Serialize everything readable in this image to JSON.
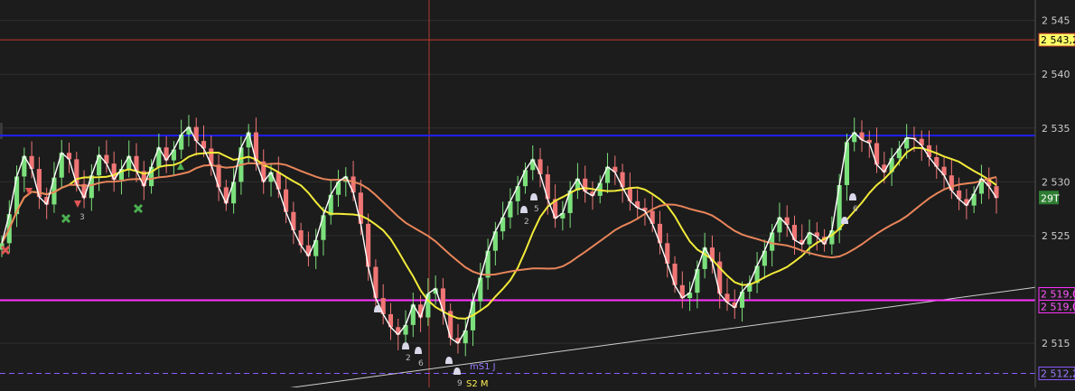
{
  "chart_data": {
    "type": "candlestick",
    "title": "",
    "xlabel": "",
    "ylabel": "",
    "grid": true,
    "ylim": [
      2510.9,
      2546.9
    ],
    "y_ticks": [
      2545,
      2540,
      2535,
      2530,
      2525,
      2515
    ],
    "y_tick_labels": [
      "2 545",
      "2 540",
      "2 535",
      "2 530",
      "2 525",
      "2 515"
    ],
    "price_series_close": [
      2524.3,
      2527.0,
      2530.5,
      2532.4,
      2531.2,
      2528.6,
      2527.9,
      2530.4,
      2532.7,
      2532.1,
      2529.8,
      2528.5,
      2530.6,
      2532.5,
      2531.7,
      2530.2,
      2531.2,
      2532.4,
      2531.0,
      2529.6,
      2531.4,
      2533.2,
      2532.0,
      2533.0,
      2534.4,
      2535.1,
      2533.8,
      2533.1,
      2531.6,
      2529.5,
      2528.0,
      2530.0,
      2533.2,
      2534.6,
      2531.9,
      2530.0,
      2530.9,
      2529.3,
      2527.2,
      2525.5,
      2524.1,
      2523.1,
      2524.6,
      2526.9,
      2528.8,
      2530.0,
      2530.5,
      2529.0,
      2526.1,
      2522.1,
      2519.2,
      2517.7,
      2516.5,
      2515.8,
      2516.7,
      2518.6,
      2517.4,
      2519.6,
      2520.1,
      2518.0,
      2515.5,
      2515.0,
      2516.2,
      2518.9,
      2521.1,
      2523.6,
      2525.4,
      2526.7,
      2528.2,
      2529.6,
      2531.1,
      2532.1,
      2530.7,
      2528.4,
      2526.6,
      2527.1,
      2529.2,
      2530.3,
      2529.1,
      2528.7,
      2529.9,
      2531.4,
      2530.9,
      2529.5,
      2528.2,
      2527.6,
      2527.3,
      2526.1,
      2524.3,
      2522.4,
      2520.4,
      2519.2,
      2519.7,
      2521.9,
      2523.9,
      2522.6,
      2519.6,
      2518.8,
      2518.3,
      2519.8,
      2520.6,
      2522.2,
      2523.6,
      2525.3,
      2526.7,
      2526.0,
      2524.6,
      2524.2,
      2525.3,
      2524.9,
      2524.2,
      2525.5,
      2529.7,
      2533.7,
      2534.6,
      2533.9,
      2533.6,
      2531.6,
      2530.9,
      2532.2,
      2533.1,
      2534.1,
      2534.0,
      2533.4,
      2532.3,
      2531.4,
      2530.6,
      2529.2,
      2528.4,
      2527.8,
      2528.9,
      2530.3,
      2529.6,
      2528.5
    ],
    "moving_averages": [
      {
        "color": "#f2ea3a",
        "period": 10
      },
      {
        "color": "#e8855a",
        "period": 26
      }
    ],
    "horizontal_lines": [
      {
        "value": 2543.2,
        "color": "#c0392b",
        "label": "2 543,2!",
        "label_bg": "#ffff66",
        "label_color": "#000000"
      },
      {
        "value": 2534.3,
        "color": "#2020ff",
        "label": "",
        "label_bg": "",
        "label_color": ""
      },
      {
        "value": 2519.0,
        "color": "#ff33ff",
        "label": "2 519,0",
        "label_bg": "#1c1c1c",
        "label_color": "#ff55ff"
      },
      {
        "value": 2519.0,
        "color": "#ff33ff",
        "label": "2 519,0",
        "label_bg": "#1c1c1c",
        "label_color": "#ff55ff"
      },
      {
        "value": 2512.2,
        "color": "#8a5cff",
        "label": "2 512,2",
        "label_bg": "#1c1c1c",
        "label_color": "#9b7bff",
        "dashed": true
      }
    ],
    "trend_line": {
      "from": [
        0.26,
        2510.6
      ],
      "to": [
        1.0,
        2520.2
      ],
      "color": "#cfcfcf"
    },
    "current_price_tag": "29T",
    "annotations": [
      {
        "text": "3",
        "color": "#bbbbbb"
      },
      {
        "text": "2",
        "color": "#bbbbbb"
      },
      {
        "text": "6",
        "color": "#bbbbbb"
      },
      {
        "text": "2",
        "color": "#bbbbbb"
      },
      {
        "text": "5",
        "color": "#bbbbbb"
      },
      {
        "text": "6",
        "color": "#bbbbbb"
      },
      {
        "text": "9",
        "color": "#bbbbbb"
      },
      {
        "text": "mS1 J",
        "color": "#9b7bff"
      },
      {
        "text": "S2 M",
        "color": "#ffee55"
      }
    ],
    "colors": {
      "background": "#1c1c1c",
      "grid": "#2e2e2e",
      "bull": "#7be07b",
      "bear": "#f07575",
      "close_line": "#ffffff",
      "axis_text": "#cccccc",
      "crosshair": "#b03a2e"
    }
  }
}
